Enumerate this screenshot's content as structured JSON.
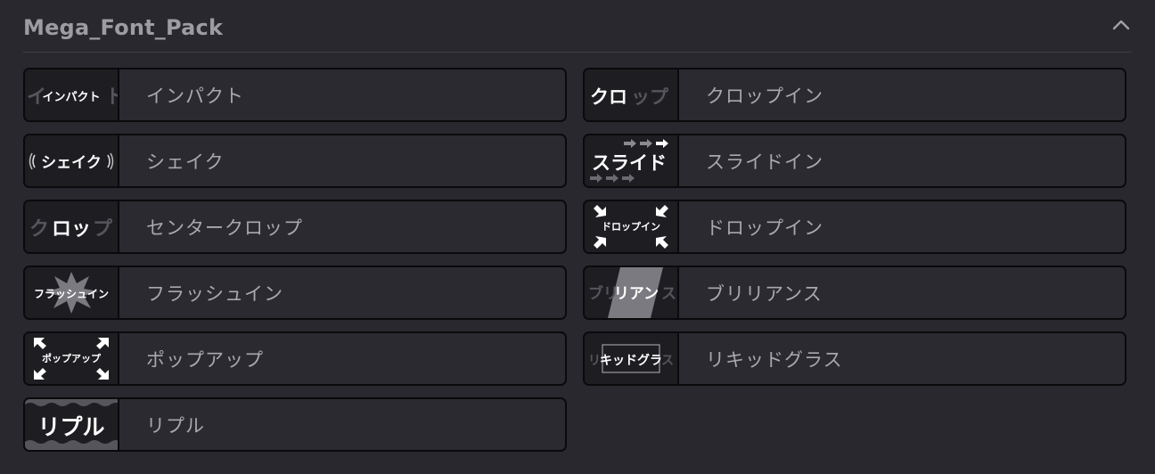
{
  "panel": {
    "title": "Mega_Font_Pack",
    "collapse_icon": "chevron-up-icon"
  },
  "effects": [
    {
      "id": "impact",
      "label": "インパクト",
      "thumb_text": "インパクト",
      "thumb_ghost": "イ　　　ト"
    },
    {
      "id": "shake",
      "label": "シェイク",
      "thumb_text": "シェイク"
    },
    {
      "id": "center-crop",
      "label": "センタークロップ",
      "thumb_text": "ロッ",
      "thumb_left": "ク",
      "thumb_right": "プ"
    },
    {
      "id": "flash-in",
      "label": "フラッシュイン",
      "thumb_text": "フラッシュイン"
    },
    {
      "id": "pop-up",
      "label": "ポップアップ",
      "thumb_text": "ポップアップ"
    },
    {
      "id": "ripple",
      "label": "リプル",
      "thumb_text": "リプル"
    },
    {
      "id": "crop-in",
      "label": "クロップイン",
      "thumb_text": "クロ",
      "thumb_dim": "ップ"
    },
    {
      "id": "slide-in",
      "label": "スライドイン",
      "thumb_text": "スライド"
    },
    {
      "id": "drop-in",
      "label": "ドロップイン",
      "thumb_text": "ドロップイン"
    },
    {
      "id": "brilliance",
      "label": "ブリリアンス",
      "thumb_left": "ブリ",
      "thumb_text": "リアン",
      "thumb_right": "ス"
    },
    {
      "id": "liquid-glass",
      "label": "リキッドグラス",
      "thumb_left": "リ",
      "thumb_text": "キッドグラ",
      "thumb_right": "ス"
    }
  ]
}
